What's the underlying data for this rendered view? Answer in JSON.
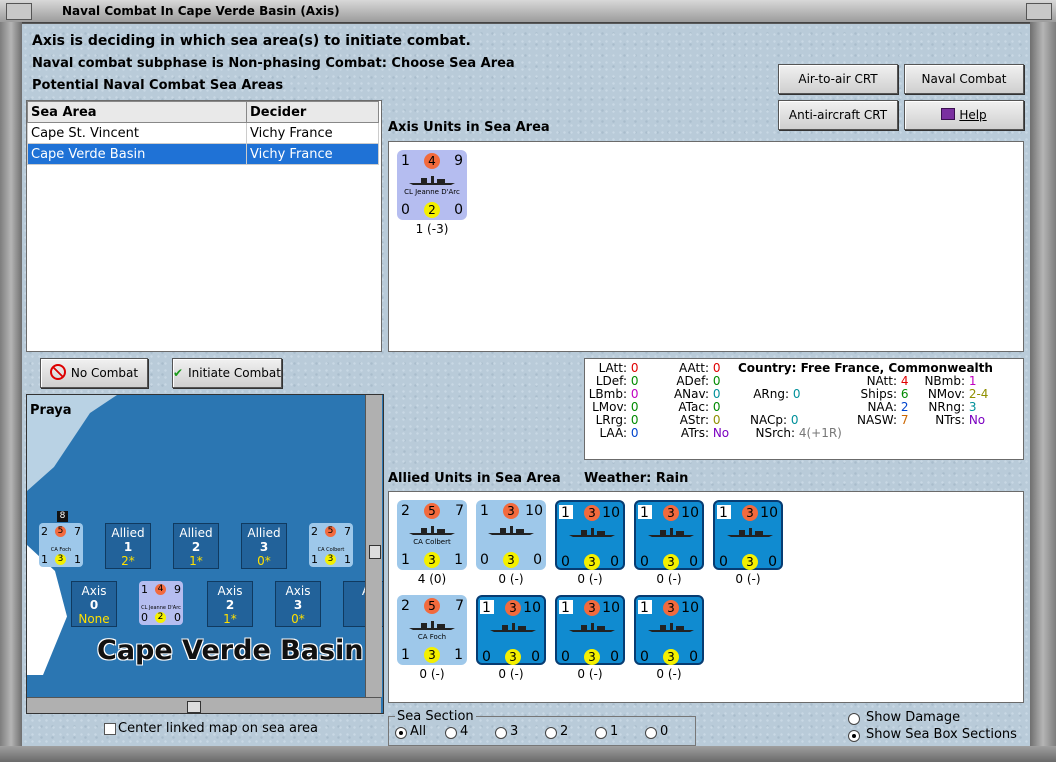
{
  "window": {
    "title": "Naval Combat In Cape Verde Basin (Axis)"
  },
  "header": {
    "line1": "Axis is deciding in which sea area(s) to initiate combat.",
    "line2": "Naval combat subphase is Non-phasing Combat: Choose Sea Area",
    "line3": "Potential Naval Combat Sea Areas"
  },
  "table": {
    "columns": [
      "Sea Area",
      "Decider"
    ],
    "rows": [
      {
        "area": "Cape St. Vincent",
        "decider": "Vichy France"
      },
      {
        "area": "Cape Verde Basin",
        "decider": "Vichy France"
      }
    ]
  },
  "buttons": {
    "air_to_air": "Air-to-air CRT",
    "naval_chart": "Naval Combat Chart",
    "anti_aircraft": "Anti-aircraft CRT",
    "help": "Help",
    "no_combat": "No Combat",
    "initiate_combat": "Initiate Combat"
  },
  "axis_units": {
    "title": "Axis Units in Sea Area",
    "unit": {
      "tl": "1",
      "tc": "4",
      "tr": "9",
      "name": "CL Jeanne D'Arc",
      "bl": "0",
      "bc": "2",
      "br": "0",
      "caption": "1 (-3)"
    }
  },
  "stats": {
    "country": "Country: Free France, Commonwealth",
    "left": [
      {
        "k": "LAtt:",
        "v": "0"
      },
      {
        "k": "LDef:",
        "v": "0"
      },
      {
        "k": "LBmb:",
        "v": "0"
      },
      {
        "k": "LMov:",
        "v": "0"
      },
      {
        "k": "LRrg:",
        "v": "0"
      },
      {
        "k": "LAA:",
        "v": "0"
      }
    ],
    "mid": [
      {
        "k": "AAtt:",
        "v": "0"
      },
      {
        "k": "ADef:",
        "v": "0"
      },
      {
        "k": "ANav:",
        "v": "0"
      },
      {
        "k": "ATac:",
        "v": "0"
      },
      {
        "k": "AStr:",
        "v": "0"
      },
      {
        "k": "ATrs:",
        "v": "No"
      }
    ],
    "arng": {
      "k": "ARng:",
      "v": "0"
    },
    "nacp": {
      "k": "NACp:",
      "v": "0"
    },
    "nsrch": {
      "k": "NSrch:",
      "v": "4(+1R)"
    },
    "right1": [
      {
        "k": "NAtt:",
        "v": "4"
      },
      {
        "k": "Ships:",
        "v": "6"
      },
      {
        "k": "NAA:",
        "v": "2"
      },
      {
        "k": "NASW:",
        "v": "7"
      }
    ],
    "right2": [
      {
        "k": "NBmb:",
        "v": "1"
      },
      {
        "k": "NMov:",
        "v": "2-4"
      },
      {
        "k": "NRng:",
        "v": "3"
      },
      {
        "k": "NTrs:",
        "v": "No"
      }
    ],
    "colors": {
      "red": "#e00000",
      "green": "#008a00",
      "blue": "#0044cc",
      "teal": "#00909a",
      "magenta": "#c000c0",
      "olive": "#909000",
      "purple": "#7a00c0",
      "orange": "#cc6600",
      "gray": "#777777"
    }
  },
  "allied": {
    "title": "Allied Units in Sea Area",
    "weather": "Weather:  Rain",
    "units": [
      {
        "tl": "2",
        "tc": "5",
        "tr": "7",
        "name": "CA Colbert",
        "bl": "1",
        "bc": "3",
        "br": "1",
        "caption": "4 (0)",
        "style": "light"
      },
      {
        "tl": "1",
        "tc": "3",
        "tr": "10",
        "name": "",
        "bl": "0",
        "bc": "3",
        "br": "0",
        "caption": "0 (-)",
        "style": "light"
      },
      {
        "tl": "1",
        "tc": "3",
        "tr": "10",
        "name": "",
        "bl": "0",
        "bc": "3",
        "br": "0",
        "caption": "0 (-)",
        "style": "dark"
      },
      {
        "tl": "1",
        "tc": "3",
        "tr": "10",
        "name": "",
        "bl": "0",
        "bc": "3",
        "br": "0",
        "caption": "0 (-)",
        "style": "dark"
      },
      {
        "tl": "1",
        "tc": "3",
        "tr": "10",
        "name": "",
        "bl": "0",
        "bc": "3",
        "br": "0",
        "caption": "0 (-)",
        "style": "dark"
      },
      {
        "tl": "2",
        "tc": "5",
        "tr": "7",
        "name": "CA Foch",
        "bl": "1",
        "bc": "3",
        "br": "1",
        "caption": "0 (-)",
        "style": "light"
      },
      {
        "tl": "1",
        "tc": "3",
        "tr": "10",
        "name": "",
        "bl": "0",
        "bc": "3",
        "br": "0",
        "caption": "0 (-)",
        "style": "dark"
      },
      {
        "tl": "1",
        "tc": "3",
        "tr": "10",
        "name": "",
        "bl": "0",
        "bc": "3",
        "br": "0",
        "caption": "0 (-)",
        "style": "dark"
      },
      {
        "tl": "1",
        "tc": "3",
        "tr": "10",
        "name": "",
        "bl": "0",
        "bc": "3",
        "br": "0",
        "caption": "0 (-)",
        "style": "dark"
      }
    ]
  },
  "map": {
    "place": "Praya",
    "sea_name": "Cape Verde Basin",
    "stack_count": "8",
    "allied_boxes": [
      {
        "title": "Allied",
        "num": "1",
        "val": "2*"
      },
      {
        "title": "Allied",
        "num": "2",
        "val": "1*"
      },
      {
        "title": "Allied",
        "num": "3",
        "val": "0*"
      }
    ],
    "axis_boxes": [
      {
        "title": "Axis",
        "num": "0",
        "val": "None"
      },
      {
        "title": "Axis",
        "num": "2",
        "val": "1*"
      },
      {
        "title": "Axis",
        "num": "3",
        "val": "0*"
      },
      {
        "title": "A",
        "num": "",
        "val": ""
      }
    ],
    "foch": {
      "tl": "2",
      "tc": "5",
      "tr": "7",
      "name": "CA Foch",
      "bl": "1",
      "bc": "3",
      "br": "1"
    },
    "colbert": {
      "tl": "2",
      "tc": "5",
      "tr": "7",
      "name": "CA Colbert",
      "bl": "1",
      "bc": "3",
      "br": "1"
    },
    "jeanne": {
      "tl": "1",
      "tc": "4",
      "tr": "9",
      "name": "CL Jeanne D'Arc",
      "bl": "0",
      "bc": "2",
      "br": "0"
    }
  },
  "center_link": "Center linked map on sea area",
  "sea_section": {
    "title": "Sea Section",
    "options": [
      "All",
      "4",
      "3",
      "2",
      "1",
      "0"
    ],
    "selected": "All"
  },
  "view": {
    "show_damage": "Show Damage",
    "show_sections": "Show Sea Box Sections",
    "selected": "show_sections"
  }
}
